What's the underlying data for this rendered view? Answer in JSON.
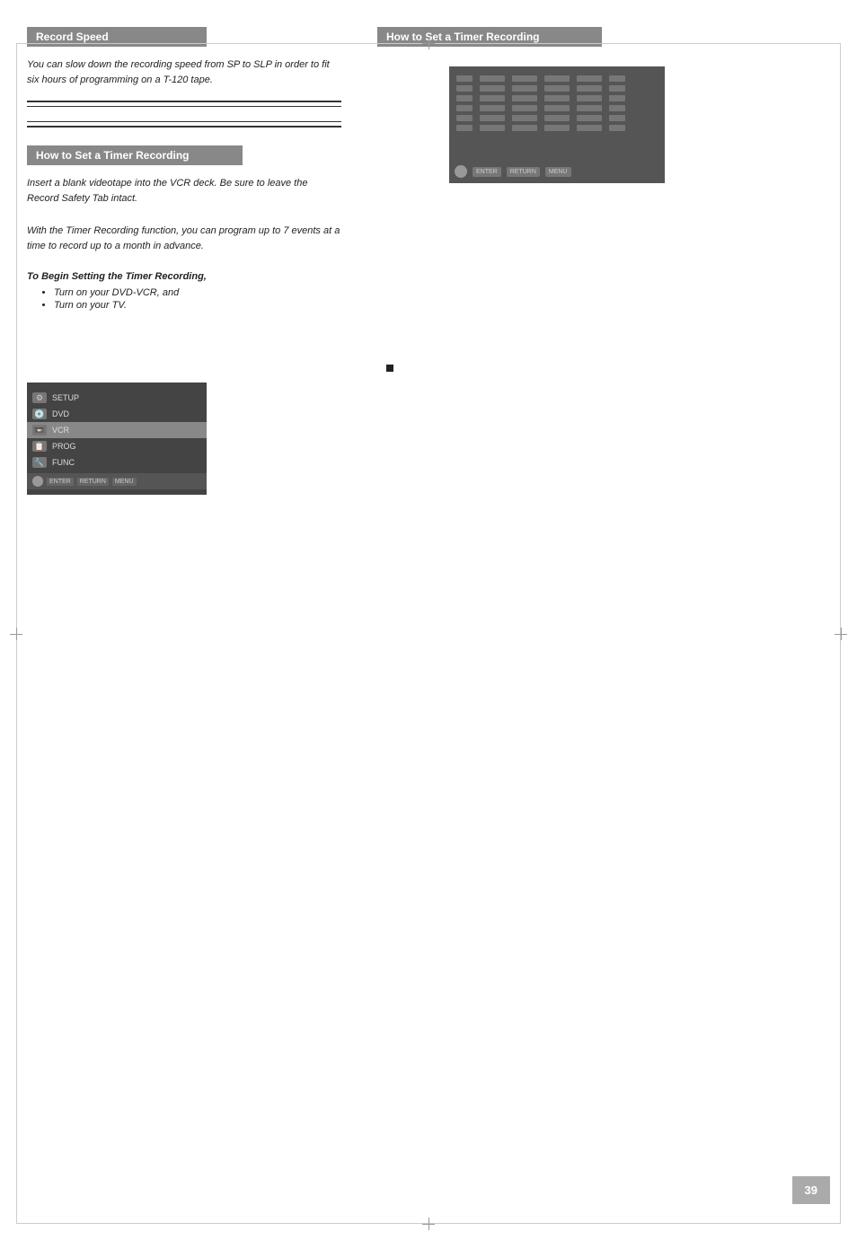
{
  "page": {
    "border_color": "#ccc",
    "background": "#fff"
  },
  "left_column": {
    "record_speed": {
      "header": "Record Speed",
      "intro_text": "You can slow down the recording speed from SP to SLP in order to fit six hours of programming on a T-120 tape."
    },
    "dividers": {
      "line1_thick": true,
      "line2_thin": true,
      "line3_thin": true,
      "line4_thick": true
    },
    "how_to_timer": {
      "header": "How to Set a Timer Recording",
      "intro1": "Insert a blank videotape into the VCR deck. Be sure to leave the Record Safety Tab intact.",
      "intro2": "With the Timer Recording function, you can program up to 7 events at a time to record up to a month in advance.",
      "to_begin": "To Begin Setting the Timer Recording,",
      "bullets": [
        "Turn on your DVD-VCR, and",
        "Turn on your TV."
      ]
    },
    "menu": {
      "items": [
        {
          "label": "SETUP",
          "icon": "gear"
        },
        {
          "label": "DVD",
          "icon": "disc"
        },
        {
          "label": "VCR",
          "icon": "vcr"
        },
        {
          "label": "PROG",
          "icon": "prog"
        },
        {
          "label": "FUNC",
          "icon": "func"
        }
      ],
      "bottom_buttons": [
        "ENTER",
        "RETURN",
        "MENU"
      ]
    }
  },
  "right_column": {
    "header": "How to Set a Timer Recording",
    "screen_rows": [
      [
        "---",
        "--- ---",
        "--- ---",
        "--- ---",
        "---"
      ],
      [
        "---",
        "--- ---",
        "--- ---",
        "--- ---",
        "---"
      ],
      [
        "---",
        "--- ---",
        "--- ---",
        "--- ---",
        "---"
      ],
      [
        "---",
        "--- ---",
        "--- ---",
        "--- ---",
        "---"
      ],
      [
        "---",
        "--- ---",
        "--- ---",
        "--- ---",
        "---"
      ],
      [
        "---",
        "--- ---",
        "--- ---",
        "--- ---",
        "---"
      ]
    ],
    "screen_buttons": [
      "ENTER",
      "RETURN",
      "MENU"
    ],
    "square_bullet_text": ""
  },
  "page_number": "39"
}
